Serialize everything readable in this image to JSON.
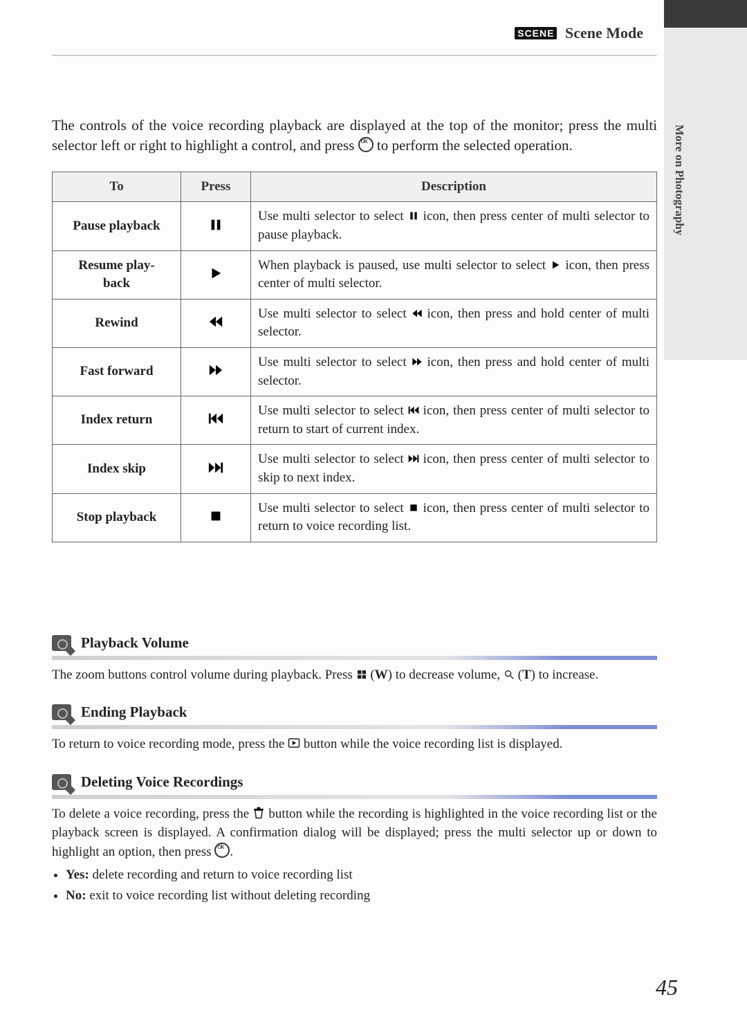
{
  "header": {
    "badge": "SCENE",
    "title": "Scene Mode"
  },
  "side_label": "More on Photography",
  "intro": {
    "p1": "The controls of the voice recording playback are displayed at the top of the monitor; press the multi selector left or right to highlight a control, and press ",
    "p2": " to perform the selected operation."
  },
  "table": {
    "head": {
      "to": "To",
      "press": "Press",
      "desc": "Description"
    },
    "rows": [
      {
        "to": "Pause playback",
        "icon": "pause",
        "d1": "Use multi selector to select ",
        "iconInline": "pause",
        "d2": " icon, then press center of multi selector to pause playback."
      },
      {
        "to": "Resume playback",
        "icon": "play",
        "d1": "When playback is paused, use multi selector to select ",
        "iconInline": "play",
        "d2": " icon, then press center of multi selector."
      },
      {
        "to": "Rewind",
        "icon": "rewind",
        "d1": "Use multi selector to select ",
        "iconInline": "rewind",
        "d2": " icon, then press and hold center of multi selector."
      },
      {
        "to": "Fast forward",
        "icon": "ffwd",
        "d1": "Use multi selector to select ",
        "iconInline": "ffwd",
        "d2": " icon, then press and hold center of multi selector."
      },
      {
        "to": "Index return",
        "icon": "skip-back",
        "d1": "Use multi selector to select ",
        "iconInline": "skip-back",
        "d2": " icon, then press center of multi selector to return to start of current index."
      },
      {
        "to": "Index skip",
        "icon": "skip-fwd",
        "d1": "Use multi selector to select ",
        "iconInline": "skip-fwd",
        "d2": " icon, then press center of multi selector to skip to next index."
      },
      {
        "to": "Stop playback",
        "icon": "stop",
        "d1": "Use multi selector to select ",
        "iconInline": "stop",
        "d2": " icon, then press center of multi selector to return to voice recording list."
      }
    ]
  },
  "notes": [
    {
      "title": "Playback Volume",
      "body_html": "The zoom buttons control volume during playback. Press {thumb} (<b>W</b>) to decrease volume, {zoom} (<b>T</b>) to increase."
    },
    {
      "title": "Ending Playback",
      "body_html": "To return to voice recording mode, press the {playbtn} button while the voice recording list is displayed."
    },
    {
      "title": "Deleting Voice Recordings",
      "body_html": "To delete a voice recording, press the {trash} button while the recording is highlighted in the voice recording list or the playback screen is displayed. A confirmation dialog will be displayed; press the multi selector up or down to highlight an option, then press {ok}.",
      "bullets": [
        "<b>Yes:</b> delete recording and return to voice recording list",
        "<b>No:</b> exit to voice recording list without deleting recording"
      ]
    }
  ],
  "page_number": "45"
}
